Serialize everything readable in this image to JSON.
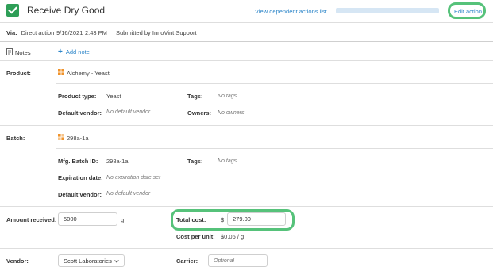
{
  "header": {
    "title": "Receive Dry Good",
    "view_dependent_link": "View dependent actions list",
    "edit_action": "Edit action"
  },
  "meta": {
    "via_label": "Via:",
    "via_value": "Direct action",
    "date": "9/16/2021",
    "time": "2:43 PM",
    "submitted_by": "Submitted by InnoVint Support"
  },
  "notes": {
    "label": "Notes",
    "add_note": "Add note"
  },
  "product": {
    "label": "Product:",
    "name": "Alchemy - Yeast",
    "type_label": "Product type:",
    "type_value": "Yeast",
    "tags_label": "Tags:",
    "tags_value": "No tags",
    "default_vendor_label": "Default vendor:",
    "default_vendor_value": "No default vendor",
    "owners_label": "Owners:",
    "owners_value": "No owners"
  },
  "batch": {
    "label": "Batch:",
    "name": "298a-1a",
    "mfg_label": "Mfg. Batch ID:",
    "mfg_value": "298a-1a",
    "tags_label": "Tags:",
    "tags_value": "No tags",
    "expiration_label": "Expiration date:",
    "expiration_value": "No expiration date set",
    "default_vendor_label": "Default vendor:",
    "default_vendor_value": "No default vendor"
  },
  "amount": {
    "label": "Amount received:",
    "value": "5000",
    "unit": "g",
    "total_cost_label": "Total cost:",
    "currency": "$",
    "total_cost_value": "279.00",
    "cost_per_unit_label": "Cost per unit:",
    "cost_per_unit_value": "$0.06 / g"
  },
  "vendor": {
    "label": "Vendor:",
    "value": "Scott Laboratories",
    "carrier_label": "Carrier:",
    "carrier_placeholder": "Optional"
  },
  "colors": {
    "check_green": "#2e9e57",
    "highlight": "#56c27a",
    "link": "#2d86c9",
    "product_icon": "#f0932b"
  }
}
